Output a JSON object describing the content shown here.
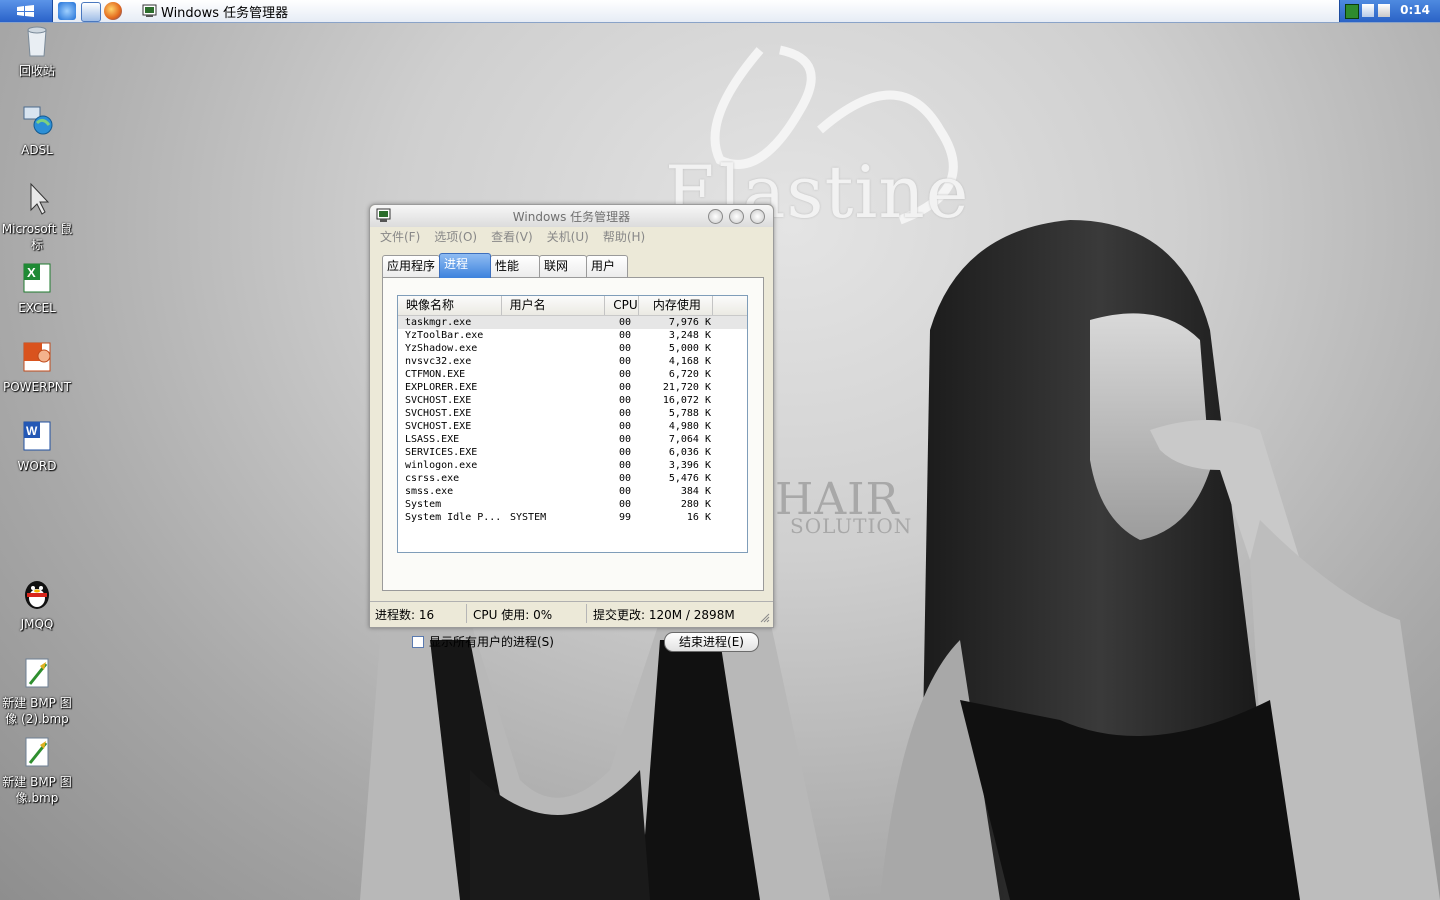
{
  "taskbar": {
    "task_button_label": "Windows 任务管理器",
    "clock": "0:14",
    "quick_launch": [
      "ie-icon",
      "document-icon",
      "firefox-icon"
    ]
  },
  "desktop_icons": [
    {
      "label": "回收站",
      "icon": "recycle-bin-icon"
    },
    {
      "label": "ADSL",
      "icon": "network-connection-icon"
    },
    {
      "label": "Microsoft 鼠标",
      "icon": "mouse-pointer-icon"
    },
    {
      "label": "EXCEL",
      "icon": "excel-icon"
    },
    {
      "label": "POWERPNT",
      "icon": "powerpoint-icon"
    },
    {
      "label": "WORD",
      "icon": "word-icon"
    },
    {
      "label": "JMQQ",
      "icon": "qq-penguin-icon"
    },
    {
      "label": "新建 BMP 图像 (2).bmp",
      "icon": "bitmap-file-icon"
    },
    {
      "label": "新建 BMP 图像.bmp",
      "icon": "bitmap-file-icon"
    }
  ],
  "wallpaper": {
    "brand_name": "Elastine",
    "line1": "HAIR",
    "line2": "SOLUTION"
  },
  "task_manager": {
    "title": "Windows 任务管理器",
    "menu": [
      "文件(F)",
      "选项(O)",
      "查看(V)",
      "关机(U)",
      "帮助(H)"
    ],
    "tabs": [
      "应用程序",
      "进程",
      "性能",
      "联网",
      "用户"
    ],
    "active_tab": "进程",
    "columns": {
      "image": "映像名称",
      "user": "用户名",
      "cpu": "CPU",
      "mem": "内存使用"
    },
    "processes": [
      {
        "name": "taskmgr.exe",
        "user": "",
        "cpu": "00",
        "mem": "7,976 K"
      },
      {
        "name": "YzToolBar.exe",
        "user": "",
        "cpu": "00",
        "mem": "3,248 K"
      },
      {
        "name": "YzShadow.exe",
        "user": "",
        "cpu": "00",
        "mem": "5,000 K"
      },
      {
        "name": "nvsvc32.exe",
        "user": "",
        "cpu": "00",
        "mem": "4,168 K"
      },
      {
        "name": "CTFMON.EXE",
        "user": "",
        "cpu": "00",
        "mem": "6,720 K"
      },
      {
        "name": "EXPLORER.EXE",
        "user": "",
        "cpu": "00",
        "mem": "21,720 K"
      },
      {
        "name": "SVCHOST.EXE",
        "user": "",
        "cpu": "00",
        "mem": "16,072 K"
      },
      {
        "name": "SVCHOST.EXE",
        "user": "",
        "cpu": "00",
        "mem": "5,788 K"
      },
      {
        "name": "SVCHOST.EXE",
        "user": "",
        "cpu": "00",
        "mem": "4,980 K"
      },
      {
        "name": "LSASS.EXE",
        "user": "",
        "cpu": "00",
        "mem": "7,064 K"
      },
      {
        "name": "SERVICES.EXE",
        "user": "",
        "cpu": "00",
        "mem": "6,036 K"
      },
      {
        "name": "winlogon.exe",
        "user": "",
        "cpu": "00",
        "mem": "3,396 K"
      },
      {
        "name": "csrss.exe",
        "user": "",
        "cpu": "00",
        "mem": "5,476 K"
      },
      {
        "name": "smss.exe",
        "user": "",
        "cpu": "00",
        "mem": "384 K"
      },
      {
        "name": "System",
        "user": "",
        "cpu": "00",
        "mem": "280 K"
      },
      {
        "name": "System Idle P...",
        "user": "SYSTEM",
        "cpu": "99",
        "mem": "16 K"
      }
    ],
    "show_all_users_label": "显示所有用户的进程(S)",
    "show_all_users_checked": false,
    "end_process_label": "结束进程(E)",
    "status": {
      "processes": "进程数: 16",
      "cpu": "CPU 使用: 0%",
      "commit": "提交更改: 120M / 2898M"
    }
  },
  "colors": {
    "title_active_tab": "#3d82dd",
    "taskbar_blue": "#2a62c9"
  }
}
